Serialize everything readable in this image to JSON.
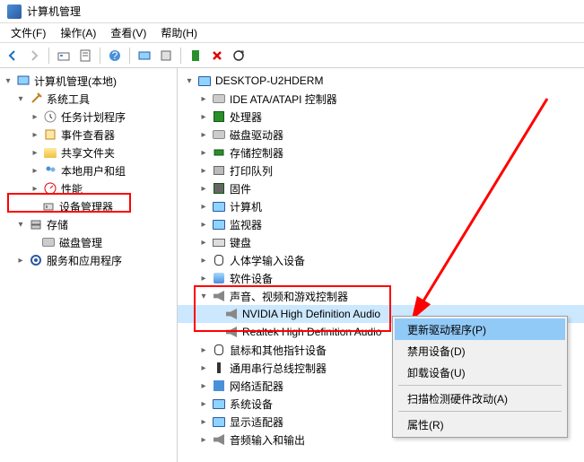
{
  "window": {
    "title": "计算机管理"
  },
  "menu": {
    "file": "文件(F)",
    "action": "操作(A)",
    "view": "查看(V)",
    "help": "帮助(H)"
  },
  "left_tree": {
    "root": "计算机管理(本地)",
    "system_tools": "系统工具",
    "task_scheduler": "任务计划程序",
    "event_viewer": "事件查看器",
    "shared_folders": "共享文件夹",
    "local_users": "本地用户和组",
    "performance": "性能",
    "device_manager": "设备管理器",
    "storage": "存储",
    "disk_mgmt": "磁盘管理",
    "services_apps": "服务和应用程序"
  },
  "right_tree": {
    "computer": "DESKTOP-U2HDERM",
    "ide": "IDE ATA/ATAPI 控制器",
    "cpu": "处理器",
    "disk_drives": "磁盘驱动器",
    "storage_ctrl": "存储控制器",
    "print_queue": "打印队列",
    "firmware": "固件",
    "computer_cat": "计算机",
    "monitors": "监视器",
    "keyboards": "键盘",
    "hid": "人体学输入设备",
    "software_dev": "软件设备",
    "sound": "声音、视频和游戏控制器",
    "nvidia": "NVIDIA High Definition Audio",
    "realtek": "Realtek High Definition Audio",
    "mice": "鼠标和其他指针设备",
    "usb": "通用串行总线控制器",
    "network": "网络适配器",
    "system_dev": "系统设备",
    "display": "显示适配器",
    "audio_io": "音频输入和输出"
  },
  "context_menu": {
    "update": "更新驱动程序(P)",
    "disable": "禁用设备(D)",
    "uninstall": "卸载设备(U)",
    "scan": "扫描检测硬件改动(A)",
    "properties": "属性(R)"
  }
}
